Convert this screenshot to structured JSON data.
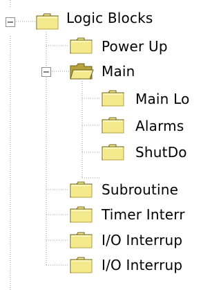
{
  "tree": {
    "nodes": [
      {
        "label": "Logic Blocks",
        "icon": "folder-closed-icon",
        "expander": "minus",
        "name": "tree-node-logic-blocks"
      },
      {
        "label": "Power Up",
        "icon": "folder-closed-icon",
        "name": "tree-node-power-up"
      },
      {
        "label": "Main",
        "icon": "folder-open-icon",
        "expander": "minus",
        "name": "tree-node-main"
      },
      {
        "label": "Main Lo",
        "icon": "folder-closed-icon",
        "name": "tree-node-main-logic"
      },
      {
        "label": "Alarms",
        "icon": "folder-closed-icon",
        "name": "tree-node-alarms"
      },
      {
        "label": "ShutDo",
        "icon": "folder-closed-icon",
        "name": "tree-node-shutdown"
      },
      {
        "label": "Subroutine",
        "icon": "folder-closed-icon",
        "name": "tree-node-subroutine"
      },
      {
        "label": "Timer Interr",
        "icon": "folder-closed-icon",
        "name": "tree-node-timer-interrupt"
      },
      {
        "label": "I/O Interrup",
        "icon": "folder-closed-icon",
        "name": "tree-node-io-interrupt-1"
      },
      {
        "label": "I/O Interrup",
        "icon": "folder-closed-icon",
        "name": "tree-node-io-interrupt-2"
      }
    ]
  },
  "colors": {
    "folder_fill": "#f4e88c",
    "folder_highlight": "#fffbd0",
    "folder_outline": "#6b5f1e",
    "folder_shadow": "#b6a33c",
    "tree_line": "#9a9a9a",
    "text": "#000000"
  }
}
